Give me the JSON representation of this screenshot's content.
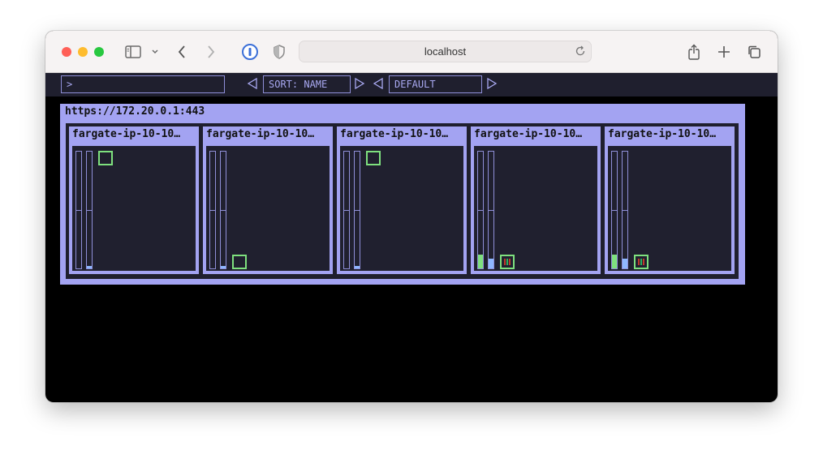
{
  "browser": {
    "url": "localhost"
  },
  "toolbar": {
    "filter_value": ">",
    "sort_label": "SORT: NAME",
    "group_label": "DEFAULT",
    "triangle_left": "◁",
    "triangle_right": "▷"
  },
  "cluster": {
    "label": "https://172.20.0.1:443"
  },
  "colors": {
    "accent": "#a3a3f2",
    "panel": "#1f1f2e",
    "pod_border": "#7ee07e",
    "meter_border": "#8f8fd8"
  },
  "nodes": [
    {
      "label": "fargate-ip-10-10…",
      "pod_position": "top",
      "cpu_fraction": 0.0,
      "mem_fraction": 0.02,
      "pod_bars": []
    },
    {
      "label": "fargate-ip-10-10…",
      "pod_position": "bottom",
      "cpu_fraction": 0.0,
      "mem_fraction": 0.02,
      "pod_bars": []
    },
    {
      "label": "fargate-ip-10-10…",
      "pod_position": "top",
      "cpu_fraction": 0.0,
      "mem_fraction": 0.02,
      "pod_bars": []
    },
    {
      "label": "fargate-ip-10-10…",
      "pod_position": "bottom",
      "cpu_fraction": 0.12,
      "mem_fraction": 0.08,
      "pod_bars": [
        "#c0392b",
        "#27ae60",
        "#c0392b"
      ]
    },
    {
      "label": "fargate-ip-10-10…",
      "pod_position": "bottom",
      "cpu_fraction": 0.12,
      "mem_fraction": 0.08,
      "pod_bars": [
        "#c0392b",
        "#27ae60",
        "#c0392b"
      ]
    }
  ]
}
